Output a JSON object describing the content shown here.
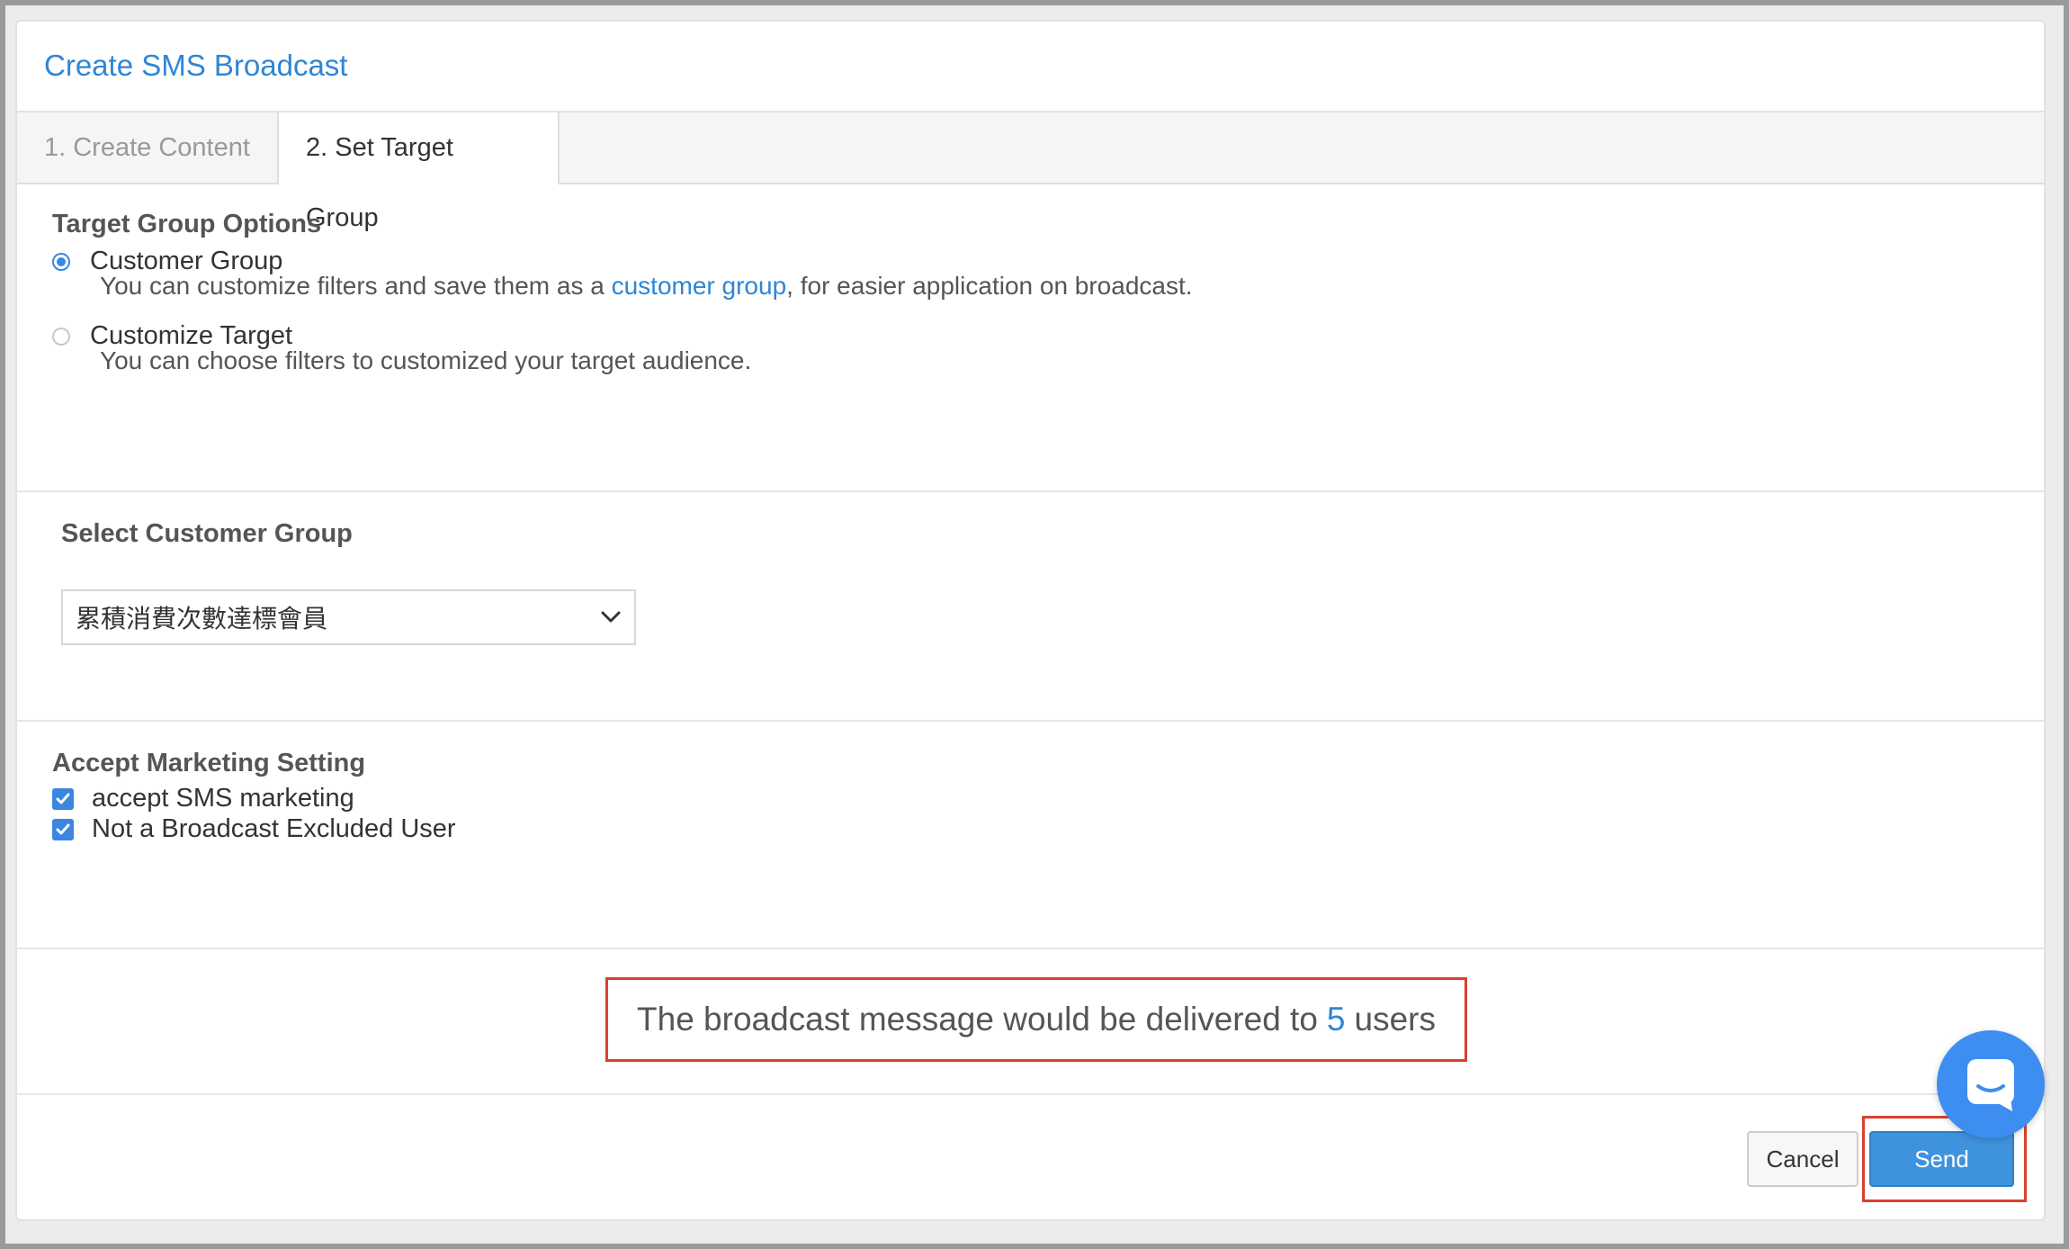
{
  "window": {
    "title": "Create SMS Broadcast"
  },
  "tabs": [
    {
      "label": "1. Create Content",
      "active": false
    },
    {
      "label": "2. Set Target Group",
      "active": true
    }
  ],
  "target_options": {
    "heading": "Target Group Options",
    "customer_group": {
      "label": "Customer Group",
      "selected": true,
      "desc_before": "You can customize filters and save them as a ",
      "desc_link": "customer group",
      "desc_after": ", for easier application on broadcast."
    },
    "customize_target": {
      "label": "Customize Target",
      "selected": false,
      "desc": "You can choose filters to customized your target audience."
    }
  },
  "select_group": {
    "heading": "Select Customer Group",
    "value": "累積消費次數達標會員"
  },
  "marketing": {
    "heading": "Accept Marketing Setting",
    "options": [
      {
        "label": "accept SMS marketing",
        "checked": true
      },
      {
        "label": "Not a Broadcast Excluded User",
        "checked": true
      }
    ]
  },
  "summary": {
    "prefix": "The broadcast message would be delivered to",
    "count": "5",
    "suffix": "users"
  },
  "actions": {
    "cancel_label": "Cancel",
    "send_label": "Send"
  },
  "icons": {
    "chat": "chat-bubble-icon",
    "chevron": "chevron-down-icon",
    "check": "checkmark-icon"
  },
  "colors": {
    "accent": "#2e86d6",
    "primary_button": "#3f93dd",
    "highlight": "#d9412f",
    "chat": "#3d8ef0"
  }
}
